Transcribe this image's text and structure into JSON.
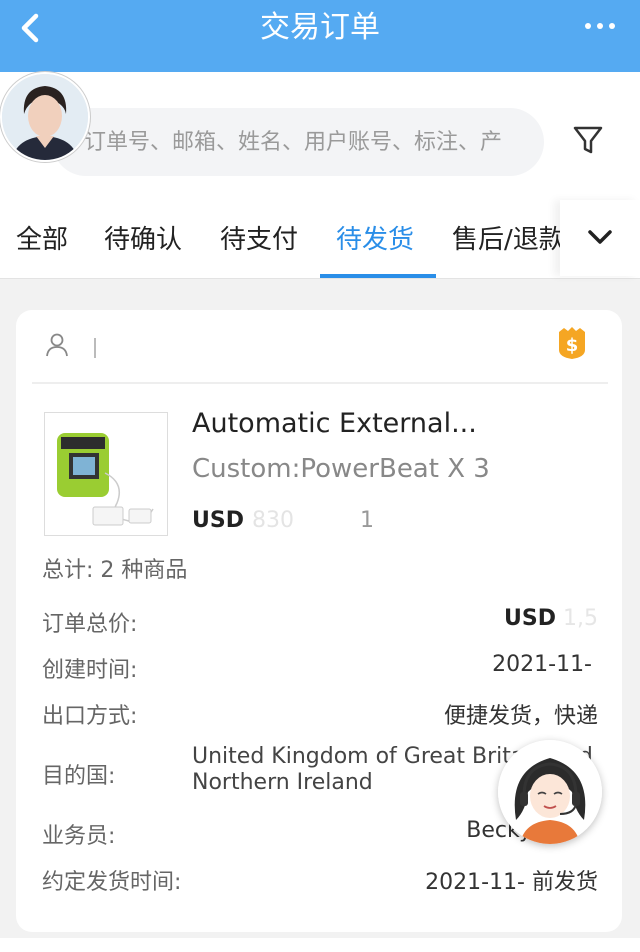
{
  "header": {
    "title": "交易订单",
    "back_icon": "chevron-left-icon",
    "more_label": "•••"
  },
  "search": {
    "placeholder": "订单号、邮箱、姓名、用户账号、标注、产",
    "filter_icon": "filter-icon"
  },
  "tabs": {
    "items": [
      {
        "label": "全部"
      },
      {
        "label": "待确认"
      },
      {
        "label": "待支付"
      },
      {
        "label": "待发货"
      },
      {
        "label": "售后/退款"
      }
    ],
    "active_index": 3,
    "more_icon": "chevron-down-icon"
  },
  "order": {
    "product": {
      "title": "Automatic External...",
      "sku": "Custom:PowerBeat X 3",
      "price_currency": "USD",
      "price_blurred": "830",
      "price_blurred_tail": "1"
    },
    "total_items": "总计: 2 种商品",
    "rows": {
      "total_price": {
        "label": "订单总价:",
        "currency": "USD",
        "value": "1,5"
      },
      "created": {
        "label": "创建时间:",
        "value": "2021-11-"
      },
      "export_method": {
        "label": "出口方式:",
        "value": "便捷发货，快递"
      },
      "destination": {
        "label": "目的国:",
        "value": "United Kingdom of Great Britain and Northern Ireland"
      },
      "salesperson": {
        "label": "业务员:",
        "value": "Becky"
      },
      "ship_by": {
        "label": "约定发货时间:",
        "value": "2021-11-  前发货"
      }
    }
  },
  "colors": {
    "header_bg": "#55aaf2",
    "accent": "#2a8ee8",
    "badge": "#f5a623"
  }
}
